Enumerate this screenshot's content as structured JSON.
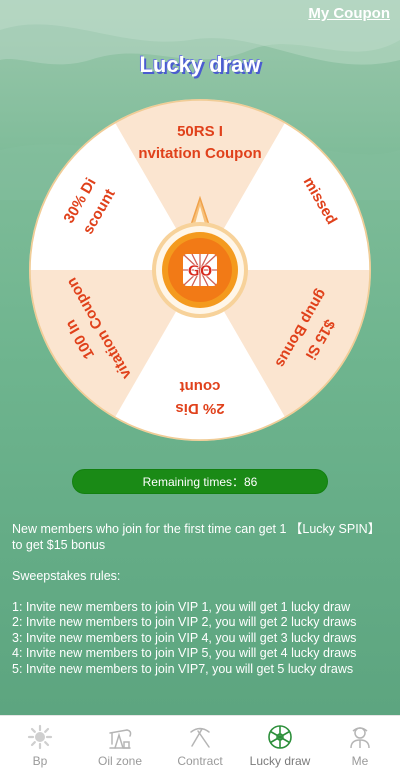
{
  "header": {
    "coupon_link": "My Coupon",
    "title": "Lucky draw"
  },
  "wheel": {
    "segments": [
      {
        "line1": "50RS I",
        "line2": "nvitation Coupon",
        "color": "#fbe5d0"
      },
      {
        "line1": "missed",
        "line2": "",
        "color": "#ffffff"
      },
      {
        "line1": "$15 Si",
        "line2": "gnup Bonus",
        "color": "#fbe5d0"
      },
      {
        "line1": "2% Dis",
        "line2": "count",
        "color": "#ffffff"
      },
      {
        "line1": "100 In",
        "line2": "vitation Coupon",
        "color": "#fbe5d0"
      },
      {
        "line1": "30% Di",
        "line2": "scount",
        "color": "#ffffff"
      }
    ],
    "center_button": "GO",
    "label_color": "#e0411b"
  },
  "remaining": {
    "label": "Remaining times：",
    "count": "86",
    "color": "#1a8a16"
  },
  "rules": {
    "intro": "New members who join for the first time can get 1 【Lucky SPIN】to get $15 bonus",
    "heading": "Sweepstakes rules:",
    "items": [
      "1: Invite new members to join VIP 1, you will get 1 lucky draw",
      "2: Invite new members to join VIP 2, you will get 2 lucky draws",
      "3: Invite new members to join VIP 4, you will get 3 lucky draws",
      "4: Invite new members to join VIP 5, you will get 4 lucky draws",
      "5: Invite new members to join VIP7, you will get 5 lucky draws"
    ]
  },
  "tabs": [
    {
      "label": "Bp",
      "icon": "bp-sun-icon"
    },
    {
      "label": "Oil zone",
      "icon": "oil-pump-icon"
    },
    {
      "label": "Contract",
      "icon": "pickaxe-icon"
    },
    {
      "label": "Lucky draw",
      "icon": "wheel-icon",
      "active": true
    },
    {
      "label": "Me",
      "icon": "user-icon"
    }
  ]
}
